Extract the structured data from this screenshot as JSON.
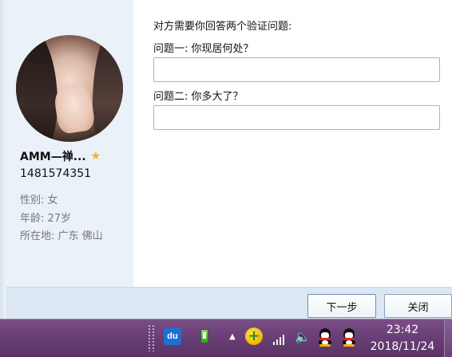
{
  "dialog": {
    "prompt": "对方需要你回答两个验证问题:",
    "question1_label": "问题一: 你现居何处？",
    "question1_value": "",
    "question2_label": "问题二: 你多大了？",
    "question2_value": ""
  },
  "profile": {
    "nickname": "AMM—禅...",
    "qq_number": "1481574351",
    "gender": "性别: 女",
    "age": "年龄: 27岁",
    "location": "所在地: 广东  佛山",
    "star_icon": "star-icon",
    "star_color": "#f5b120"
  },
  "buttons": {
    "next_label": "下一步",
    "close_label": "关闭"
  },
  "taskbar": {
    "time": "23:42",
    "date": "2018/11/24",
    "du_label": "du",
    "arrow_glyph": "▲",
    "plus_glyph": "+",
    "volume_glyph": "🔈",
    "tray_icons": [
      "baidu-du-icon",
      "usb-drive-icon",
      "show-hidden-icons-arrow",
      "plus-security-icon",
      "network-signal-icon",
      "volume-icon",
      "qq-icon",
      "qq-icon"
    ]
  },
  "colors": {
    "sidebar_bg": "#eaf1f8",
    "footer_bg": "#dbe7f2",
    "taskbar_bg": "#6a3f77",
    "info_text": "#777777"
  }
}
